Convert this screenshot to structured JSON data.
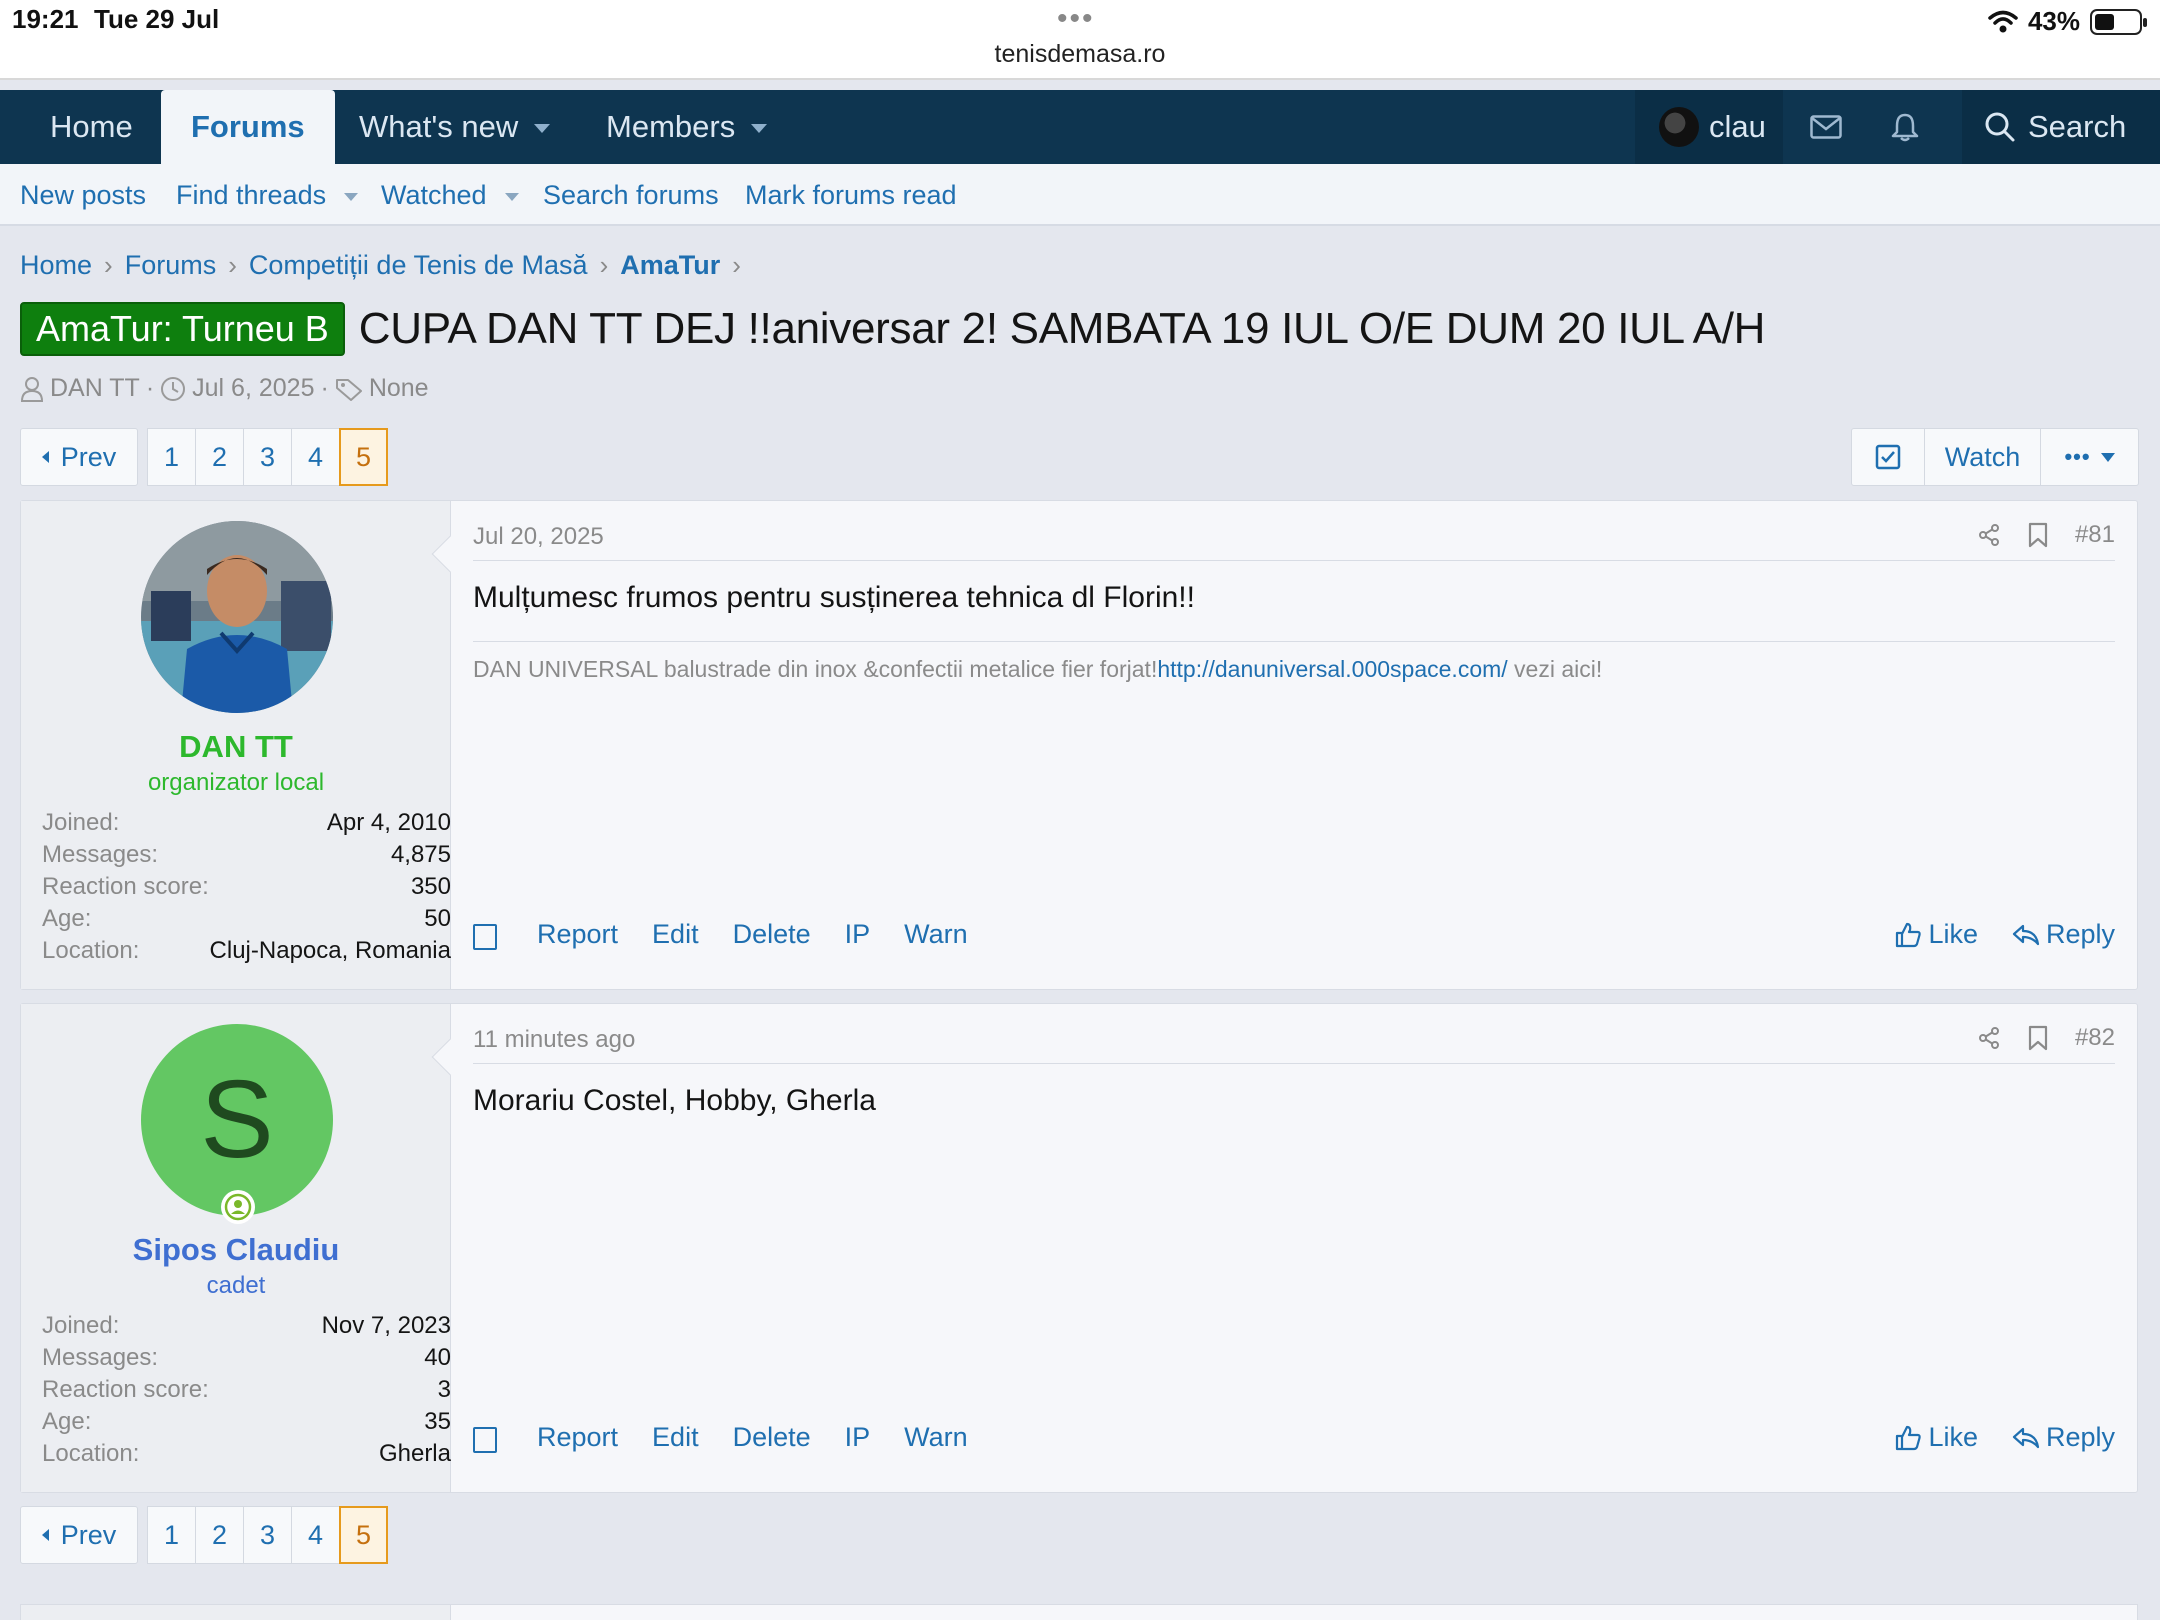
{
  "status_bar": {
    "time": "19:21",
    "date": "Tue 29 Jul",
    "url": "tenisdemasa.ro",
    "battery": "43%"
  },
  "nav": {
    "home": "Home",
    "forums": "Forums",
    "whats_new": "What's new",
    "members": "Members",
    "username": "clau",
    "search": "Search"
  },
  "subnav": {
    "new_posts": "New posts",
    "find_threads": "Find threads",
    "watched": "Watched",
    "search_forums": "Search forums",
    "mark_read": "Mark forums read"
  },
  "breadcrumb": [
    "Home",
    "Forums",
    "Competiții de Tenis de Masă",
    "AmaTur"
  ],
  "thread": {
    "prefix": "AmaTur: Turneu B",
    "title": "CUPA DAN TT DEJ !!aniversar 2! SAMBATA 19 IUL O/E DUM 20 IUL A/H",
    "author": "DAN TT",
    "start_date": "Jul 6, 2025",
    "tags": "None"
  },
  "pagination": {
    "prev": "Prev",
    "pages": [
      "1",
      "2",
      "3",
      "4",
      "5"
    ],
    "current": "5"
  },
  "thread_actions": {
    "watch": "Watch"
  },
  "post_actions": {
    "report": "Report",
    "edit": "Edit",
    "delete": "Delete",
    "ip": "IP",
    "warn": "Warn",
    "like": "Like",
    "reply": "Reply"
  },
  "stat_labels": {
    "joined": "Joined:",
    "messages": "Messages:",
    "reaction": "Reaction score:",
    "age": "Age:",
    "location": "Location:"
  },
  "posts": [
    {
      "username": "DAN TT",
      "user_title": "organizator local",
      "joined": "Apr 4, 2010",
      "messages": "4,875",
      "reaction_score": "350",
      "age": "50",
      "location": "Cluj-Napoca, Romania",
      "date": "Jul 20, 2025",
      "number": "#81",
      "body": "Mulțumesc frumos pentru susținerea tehnica dl Florin!!",
      "signature_text": "DAN UNIVERSAL balustrade din inox &confectii metalice fier forjat!",
      "signature_link": "http://danuniversal.000space.com/",
      "signature_after": " vezi aici!",
      "name_color": "#2db82d"
    },
    {
      "username": "Sipos Claudiu",
      "user_title": "cadet",
      "avatar_letter": "S",
      "joined": "Nov 7, 2023",
      "messages": "40",
      "reaction_score": "3",
      "age": "35",
      "location": "Gherla",
      "date": "11 minutes ago",
      "number": "#82",
      "body": "Morariu Costel, Hobby, Gherla",
      "name_color": "#3f6fd1"
    }
  ],
  "colors": {
    "nav_bg": "#0e3550",
    "link": "#1f6fb0",
    "prefix_bg": "#0e7f0e",
    "current_page": "#e69a1c",
    "avatar_green": "#63c763"
  }
}
